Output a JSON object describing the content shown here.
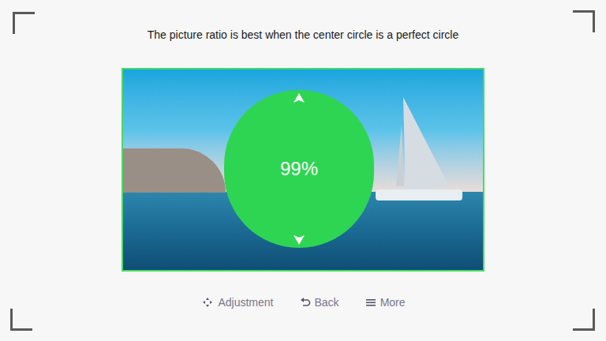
{
  "title": "The picture ratio is best when the center circle is a perfect circle",
  "indicator": {
    "value": "99%"
  },
  "hints": [
    {
      "label": "Adjustment",
      "kind": "dpad"
    },
    {
      "label": "Back",
      "kind": "back"
    },
    {
      "label": "More",
      "kind": "menu"
    }
  ]
}
